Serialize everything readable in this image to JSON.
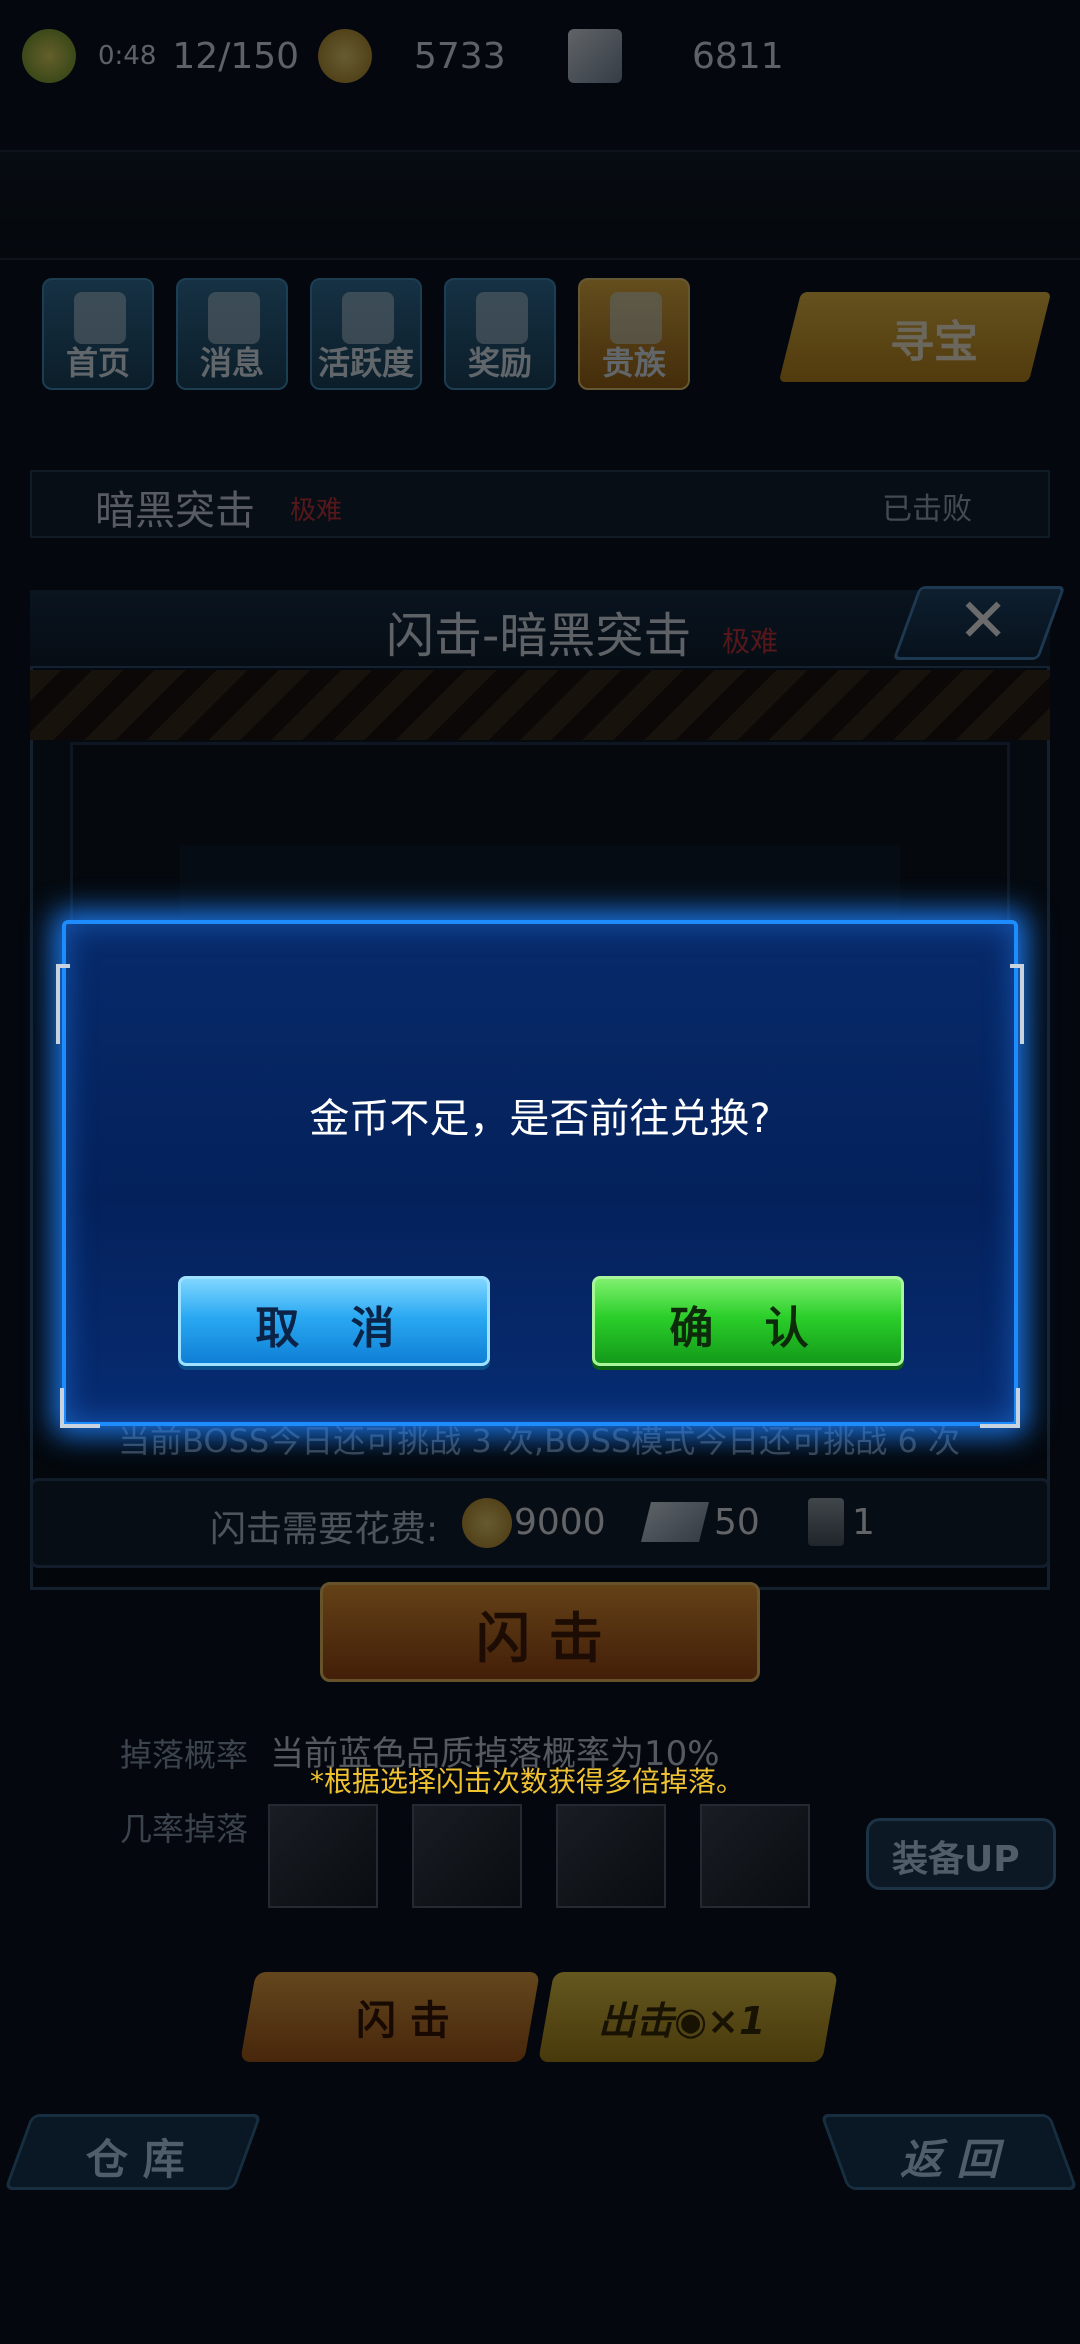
{
  "top_bar": {
    "timer": "0:48",
    "stamina": "12/150",
    "gold": "5733",
    "gems": "6811"
  },
  "nav": {
    "items": [
      "首页",
      "消息",
      "活跃度",
      "奖励",
      "贵族"
    ],
    "treasure": "寻宝"
  },
  "dungeon": {
    "name": "暗黑突击",
    "difficulty": "极难",
    "status": "已击败"
  },
  "sweep_panel": {
    "title": "闪击-暗黑突击",
    "difficulty": "极难",
    "boss_note": "当前BOSS今日还可挑战 3 次,BOSS模式今日还可挑战 6 次",
    "cost_label": "闪击需要花费:",
    "cost_gold": "9000",
    "cost_ticket": "50",
    "cost_key": "1",
    "sweep_button": "闪 击",
    "drop_rate_label": "掉落概率",
    "drop_rate_text": "当前蓝色品质掉落概率为10%",
    "drop_multi_note": "*根据选择闪击次数获得多倍掉落。",
    "drop_items_label": "几率掉落",
    "equip_up": "装备UP",
    "btn_sweep": "闪 击",
    "btn_fight": "出击◉×1",
    "btn_store": "仓 库",
    "btn_back": "返 回"
  },
  "dialog": {
    "message": "金币不足，是否前往兑换?",
    "cancel": "取 消",
    "confirm": "确 认"
  },
  "colors": {
    "dialog_border": "#1d8cff",
    "cancel": "#2aa9f2",
    "confirm": "#2bcf2a"
  }
}
